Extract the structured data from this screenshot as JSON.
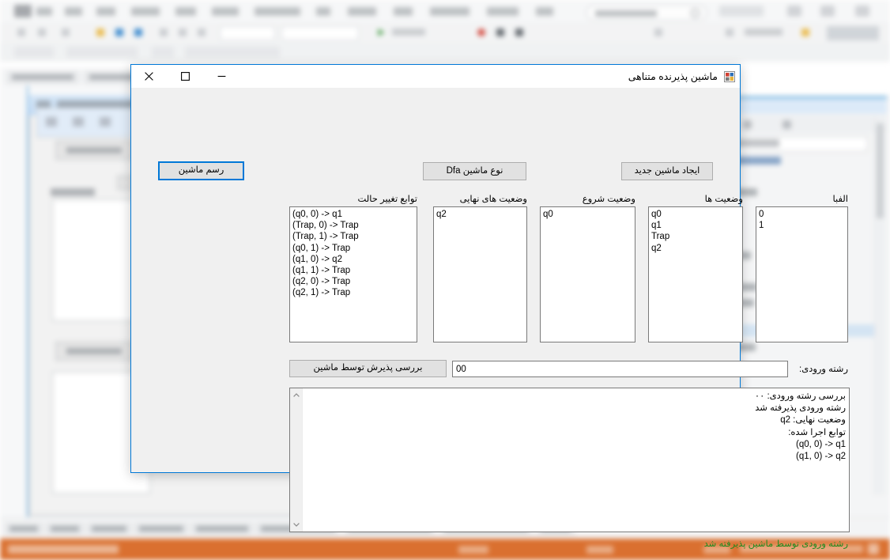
{
  "background": {
    "app": "visual-studio-ide",
    "menu_items": [
      "File",
      "Edit",
      "View",
      "Project",
      "Build",
      "Debug",
      "Architecture",
      "Test",
      "Analyze",
      "Tools",
      "Extensions",
      "Window",
      "Help"
    ],
    "search_placeholder": "Search (Ctrl+Q)",
    "run_label": "Debug",
    "platform_label": "Any CPU",
    "start_label": "Start",
    "error_list_tabs": [
      "Index",
      "Local",
      "Watch",
      "Call Stack",
      "Breakpoints",
      "Graphics Setting",
      "Command Window",
      "Immediate Window",
      "Output"
    ],
    "solution_header": "Solution Explorer",
    "status_items": [
      "Ready",
      "Ln 1",
      "Col 1",
      "Ch 1"
    ]
  },
  "dialog": {
    "title": "ماشین پذیرنده متناهی",
    "icon": "form-designer-icon",
    "window_controls": {
      "close": "close-icon",
      "maximize": "maximize-icon",
      "minimize": "minimize-icon"
    },
    "toolbar": {
      "draw_machine": "رسم ماشین",
      "machine_type": "نوع ماشین Dfa",
      "new_machine": "ایجاد ماشین جدید"
    },
    "fields": [
      {
        "key": "alphabet",
        "label": "الفبا",
        "items": [
          "0",
          "1"
        ]
      },
      {
        "key": "states",
        "label": "وضعیت ها",
        "items": [
          "q0",
          "q1",
          "Trap",
          "q2"
        ]
      },
      {
        "key": "start_state",
        "label": "وضعیت شروع",
        "items": [
          "q0"
        ]
      },
      {
        "key": "final_states",
        "label": "وضعیت های نهایی",
        "items": [
          "q2"
        ]
      },
      {
        "key": "transitions",
        "label": "توابع تغییر حالت",
        "items": [
          "(q0, 0) -> q1",
          "(Trap, 0) -> Trap",
          "(Trap, 1) -> Trap",
          "(q0, 1) -> Trap",
          "(q1, 0) -> q2",
          "(q1, 1) -> Trap",
          "(q2, 0) -> Trap",
          "(q2, 1) -> Trap"
        ]
      }
    ],
    "input_row": {
      "label": "رشته ورودی:",
      "value": "00",
      "check_button": "بررسی پذیرش توسط ماشین"
    },
    "output": {
      "lines": [
        "بررسی رشته ورودی: ۰۰",
        "رشته ورودی پذیرفته شد",
        "وضعیت نهایی: q2",
        "توابع اجرا شده:",
        "(q0, 0) -> q1",
        "(q1, 0) -> q2"
      ],
      "scroll_up_icon": "chevron-up-icon",
      "scroll_down_icon": "chevron-down-icon"
    },
    "status_message": "رشته ورودی توسط ماشین پذیرفته شد",
    "colors": {
      "accent_border": "#0078d7",
      "success_text": "#1f8a1f",
      "body_bg": "#f0f0f0",
      "titlebar_bg": "#ffffff"
    }
  }
}
